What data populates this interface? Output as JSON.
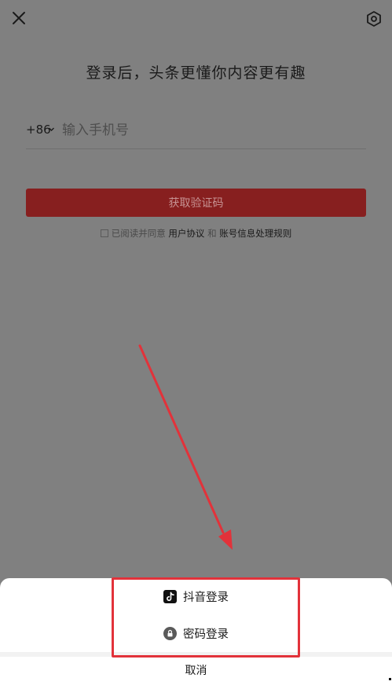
{
  "header": {
    "close_icon": "close-icon",
    "settings_icon": "settings-hexagon-icon"
  },
  "title": "登录后，头条更懂你内容更有趣",
  "phone": {
    "country_code": "+86",
    "placeholder": "输入手机号"
  },
  "get_code_label": "获取验证码",
  "agreement": {
    "prefix": "已阅读并同意",
    "user_agreement": "用户协议",
    "and": "和",
    "privacy_rules": "账号信息处理规则"
  },
  "sheet": {
    "douyin_login": "抖音登录",
    "password_login": "密码登录",
    "cancel": "取消"
  },
  "colors": {
    "overlay": "#808080",
    "primary_button": "#871f1f",
    "annotation_red": "#e2323a"
  }
}
